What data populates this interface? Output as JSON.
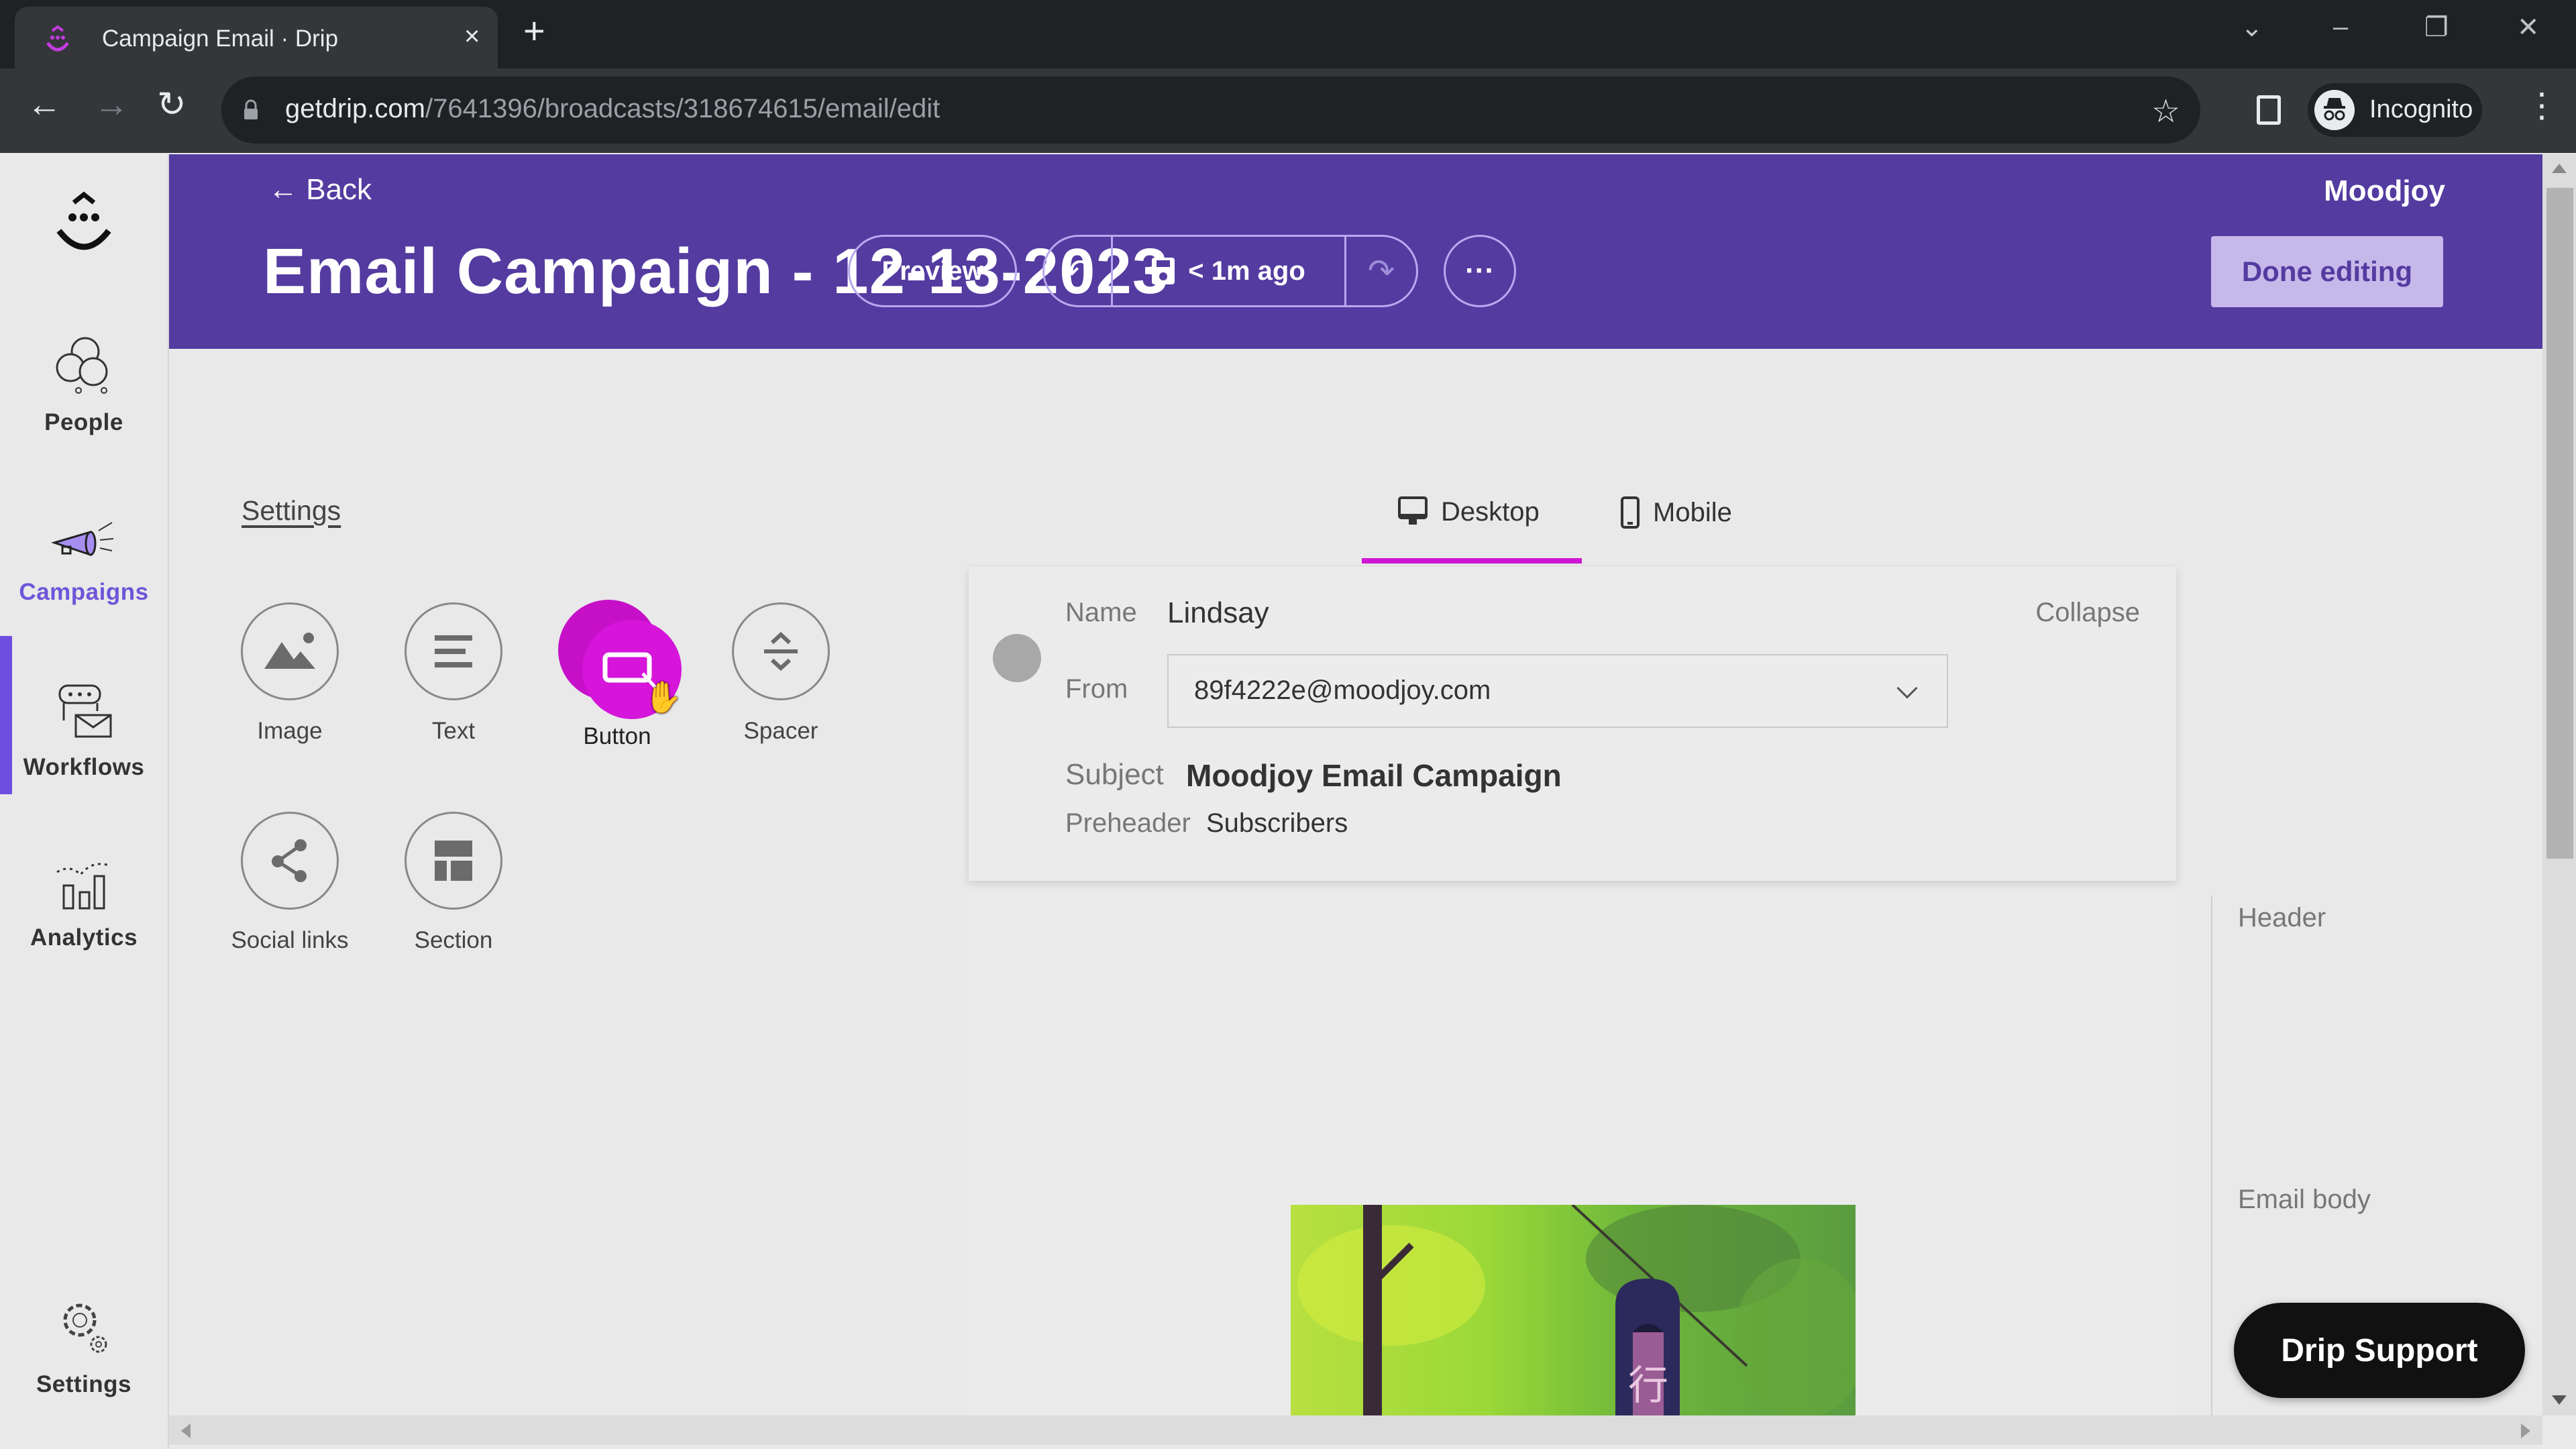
{
  "browser": {
    "tab_title": "Campaign Email · Drip",
    "tab_close": "×",
    "new_tab": "+",
    "url_host": "getdrip.com",
    "url_path": "/7641396/broadcasts/318674615/email/edit",
    "profile_label": "Incognito",
    "window_controls": [
      "⌄",
      "–",
      "❐",
      "✕"
    ]
  },
  "sidebar": {
    "items": [
      {
        "label": "People",
        "icon": "people-icon"
      },
      {
        "label": "Campaigns",
        "icon": "megaphone-icon",
        "active": true
      },
      {
        "label": "Workflows",
        "icon": "workflow-icon"
      },
      {
        "label": "Analytics",
        "icon": "analytics-icon"
      },
      {
        "label": "Settings",
        "icon": "gear-icon"
      }
    ]
  },
  "header": {
    "back_label": "Back",
    "title": "Email Campaign - 12-13-2023",
    "account": "Moodjoy",
    "preview_label": "Preview",
    "saved_status": "< 1m ago",
    "more_label": "···",
    "done_label": "Done editing",
    "accent": "#533ba0"
  },
  "blocks_panel": {
    "settings_label": "Settings",
    "blocks": [
      {
        "label": "Image",
        "icon": "image-icon"
      },
      {
        "label": "Text",
        "icon": "text-icon"
      },
      {
        "label": "Button",
        "icon": "button-icon",
        "dragging": true
      },
      {
        "label": "Spacer",
        "icon": "spacer-icon"
      },
      {
        "label": "Social links",
        "icon": "share-icon"
      },
      {
        "label": "Section",
        "icon": "section-icon"
      }
    ],
    "drag_color": "#d010d4"
  },
  "preview_tabs": {
    "tabs": [
      {
        "label": "Desktop",
        "icon": "desktop-icon",
        "active": true
      },
      {
        "label": "Mobile",
        "icon": "mobile-icon"
      }
    ],
    "underline_color": "#d016d4"
  },
  "email_meta": {
    "name_label": "Name",
    "name_value": "Lindsay",
    "from_label": "From",
    "from_value": "89f4222e@moodjoy.com",
    "subject_label": "Subject",
    "subject_value": "Moodjoy Email Campaign",
    "preheader_label": "Preheader",
    "preheader_value": "Subscribers",
    "collapse_label": "Collapse"
  },
  "outline": {
    "items": [
      "Header",
      "Email body"
    ]
  },
  "support": {
    "label": "Drip Support"
  }
}
